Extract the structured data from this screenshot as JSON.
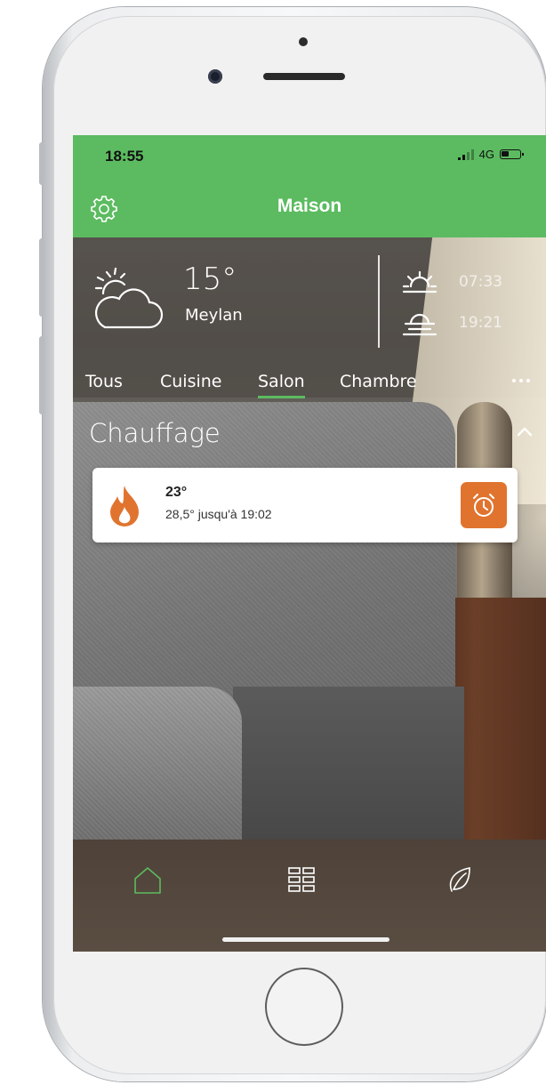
{
  "status_bar": {
    "time": "18:55",
    "network": "4G"
  },
  "header": {
    "title": "Maison"
  },
  "weather": {
    "temperature": "15°",
    "city": "Meylan",
    "sunrise": "07:33",
    "sunset": "19:21"
  },
  "tabs": [
    {
      "label": "Tous"
    },
    {
      "label": "Cuisine"
    },
    {
      "label": "Salon",
      "active": true
    },
    {
      "label": "Chambre"
    }
  ],
  "section": {
    "title": "Chauffage"
  },
  "heating_card": {
    "current": "23°",
    "override": "28,5° jusqu'à 19:02"
  },
  "colors": {
    "brand_green": "#5cbb60",
    "accent_orange": "#e0742f",
    "nav_bg": "#4e4239"
  },
  "icons": {
    "settings": "gear-icon",
    "weather": "sun-cloud-icon",
    "sunrise": "sunrise-icon",
    "sunset": "sunset-icon",
    "heating": "flame-icon",
    "timer": "stopwatch-icon",
    "nav": [
      "home-icon",
      "grid-icon",
      "leaf-icon"
    ]
  }
}
